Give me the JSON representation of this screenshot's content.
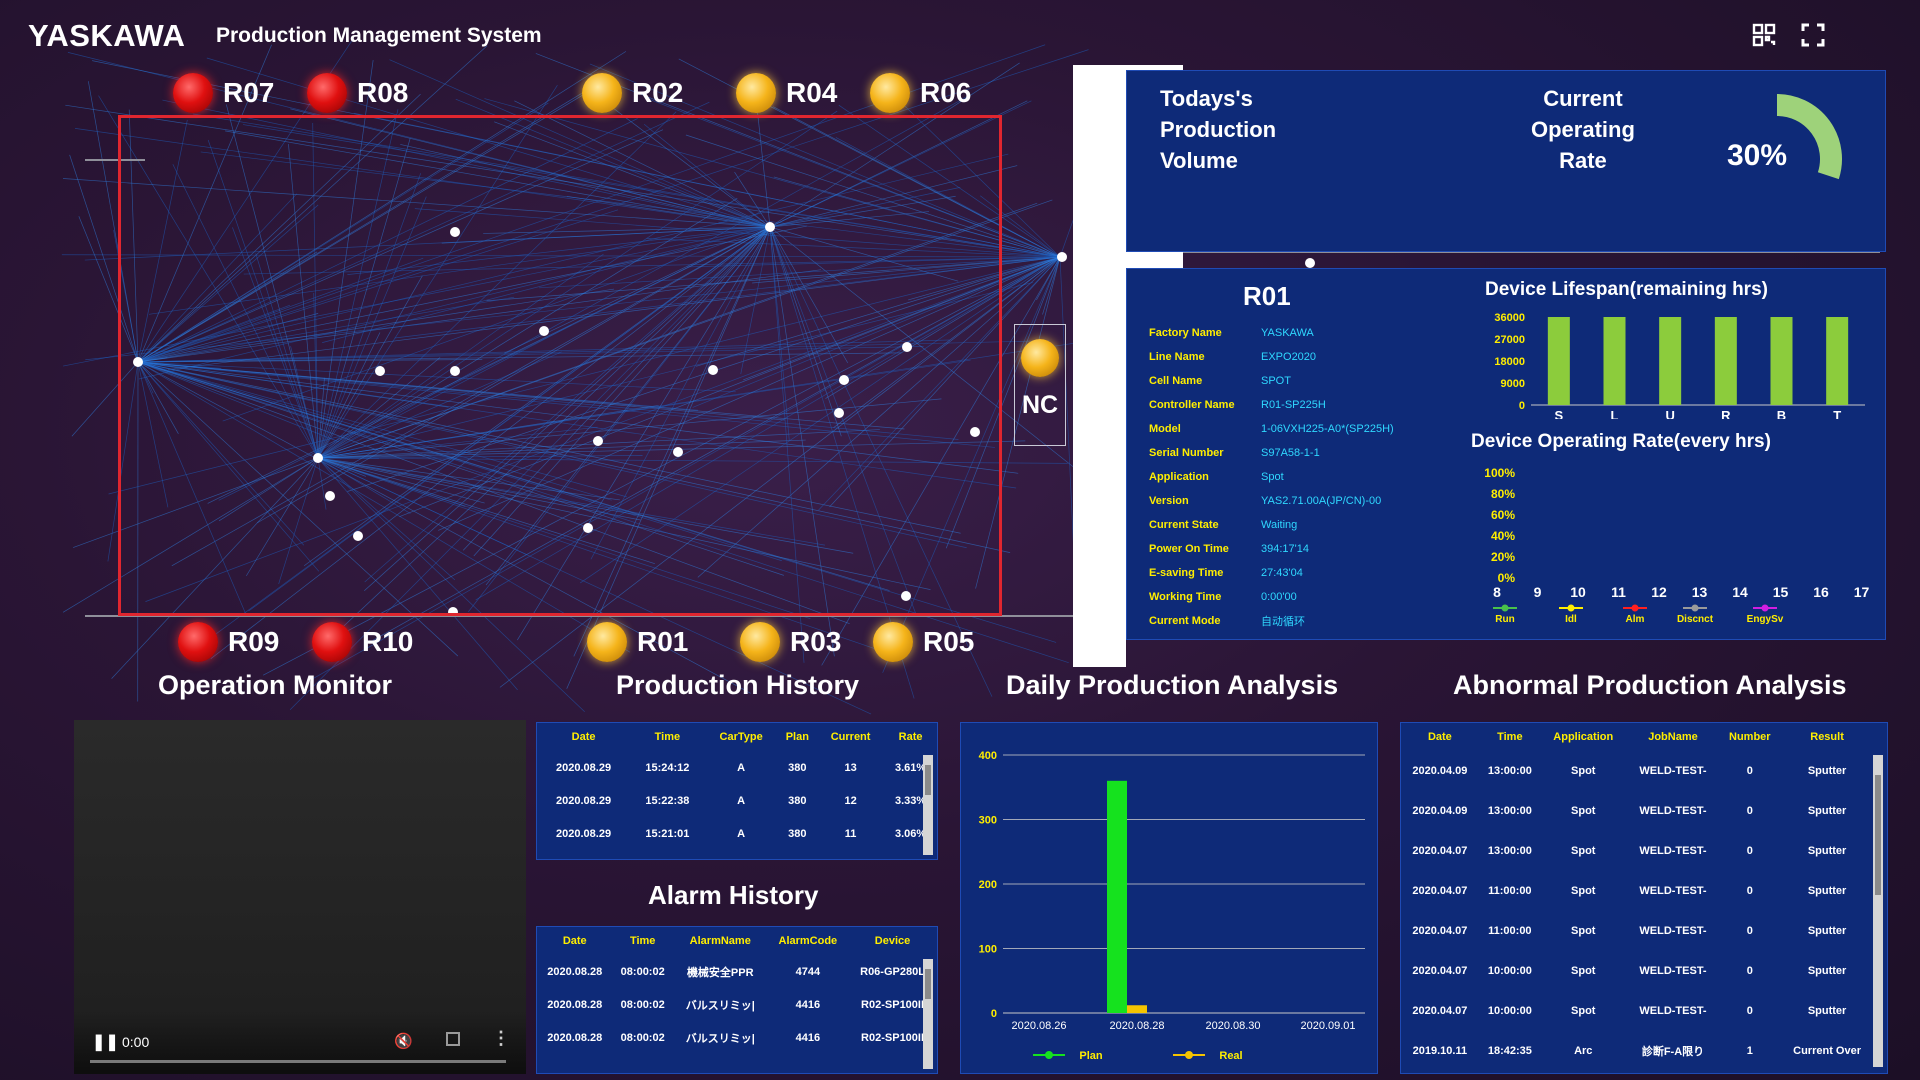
{
  "header": {
    "logo": "YASKAWA",
    "title": "Production Management System",
    "icons": [
      "qr-scan-icon",
      "fullscreen-icon"
    ]
  },
  "robots_top": [
    {
      "id": "R07",
      "status": "red"
    },
    {
      "id": "R08",
      "status": "red"
    },
    {
      "id": "R02",
      "status": "yellow"
    },
    {
      "id": "R04",
      "status": "yellow"
    },
    {
      "id": "R06",
      "status": "yellow"
    }
  ],
  "robots_bottom": [
    {
      "id": "R09",
      "status": "red"
    },
    {
      "id": "R10",
      "status": "red"
    },
    {
      "id": "R01",
      "status": "yellow"
    },
    {
      "id": "R03",
      "status": "yellow"
    },
    {
      "id": "R05",
      "status": "yellow"
    }
  ],
  "nc": {
    "label": "NC",
    "status": "yellow"
  },
  "production": {
    "volume_label": [
      "Todays's",
      "Production",
      "Volume"
    ],
    "rate_label": [
      "Current",
      "Operating",
      "Rate"
    ],
    "rate_value": "30%",
    "rate_fraction": 0.3
  },
  "r01": {
    "title": "R01",
    "info": [
      {
        "k": "Factory Name",
        "v": "YASKAWA"
      },
      {
        "k": "Line Name",
        "v": "EXPO2020"
      },
      {
        "k": "Cell Name",
        "v": "SPOT"
      },
      {
        "k": "Controller Name",
        "v": "R01-SP225H"
      },
      {
        "k": "Model",
        "v": "1-06VXH225-A0*(SP225H)"
      },
      {
        "k": "Serial Number",
        "v": "S97A58-1-1"
      },
      {
        "k": "Application",
        "v": "Spot"
      },
      {
        "k": "Version",
        "v": "YAS2.71.00A(JP/CN)-00"
      },
      {
        "k": "Current State",
        "v": "Waiting"
      },
      {
        "k": "Power On Time",
        "v": "394:17'14"
      },
      {
        "k": "E-saving Time",
        "v": "27:43'04"
      },
      {
        "k": "Working Time",
        "v": "0:00'00"
      },
      {
        "k": "Current Mode",
        "v": "自动循环"
      }
    ],
    "lifespan_title": "Device Lifespan(remaining hrs)",
    "oprate_title": "Device Operating Rate(every hrs)"
  },
  "chart_data": [
    {
      "type": "bar",
      "title": "Device Lifespan(remaining hrs)",
      "categories": [
        "S",
        "L",
        "U",
        "R",
        "B",
        "T"
      ],
      "values": [
        36000,
        36000,
        36000,
        36000,
        36000,
        36000
      ],
      "ylim": [
        0,
        36000
      ],
      "yticks": [
        "36000",
        "27000",
        "18000",
        "9000",
        "0"
      ],
      "color": "#8ccc3c"
    },
    {
      "type": "line",
      "title": "Device Operating Rate(every hrs)",
      "x": [
        "8",
        "9",
        "10",
        "11",
        "12",
        "13",
        "14",
        "15",
        "16",
        "17"
      ],
      "ylim": [
        0,
        100
      ],
      "yticks": [
        "100%",
        "80%",
        "60%",
        "40%",
        "20%",
        "0%"
      ],
      "series": [
        {
          "name": "Run",
          "color": "#49c24a",
          "values": []
        },
        {
          "name": "Idl",
          "color": "#ffee00",
          "values": []
        },
        {
          "name": "Alm",
          "color": "#ff2020",
          "values": []
        },
        {
          "name": "Discnct",
          "color": "#9a9a9a",
          "values": []
        },
        {
          "name": "EngySv",
          "color": "#d21ee0",
          "values": []
        }
      ]
    },
    {
      "type": "bar",
      "title": "Daily Production Analysis",
      "categories": [
        "2020.08.28"
      ],
      "x_ticks": [
        "2020.08.26",
        "2020.08.28",
        "2020.08.30",
        "2020.09.01"
      ],
      "ylim": [
        0,
        400
      ],
      "yticks": [
        "0",
        "100",
        "200",
        "300",
        "400"
      ],
      "series": [
        {
          "name": "Plan",
          "color": "#15e21e",
          "values": [
            360
          ]
        },
        {
          "name": "Real",
          "color": "#f5c400",
          "values": [
            12
          ]
        }
      ]
    }
  ],
  "sections": {
    "operation_monitor": "Operation Monitor",
    "production_history": "Production History",
    "daily_production": "Daily Production Analysis",
    "abnormal_production": "Abnormal Production Analysis",
    "alarm_history": "Alarm History"
  },
  "video": {
    "time": "0:00"
  },
  "production_history": {
    "columns": [
      "Date",
      "Time",
      "CarType",
      "Plan",
      "Current",
      "Rate"
    ],
    "rows": [
      [
        "2020.08.29",
        "15:24:12",
        "A",
        "380",
        "13",
        "3.61%"
      ],
      [
        "2020.08.29",
        "15:22:38",
        "A",
        "380",
        "12",
        "3.33%"
      ],
      [
        "2020.08.29",
        "15:21:01",
        "A",
        "380",
        "11",
        "3.06%"
      ]
    ]
  },
  "alarm_history": {
    "columns": [
      "Date",
      "Time",
      "AlarmName",
      "AlarmCode",
      "Device"
    ],
    "rows": [
      [
        "2020.08.28",
        "08:00:02",
        "機械安全PPR",
        "4744",
        "R06-GP280L"
      ],
      [
        "2020.08.28",
        "08:00:02",
        "バルスリミッ|",
        "4416",
        "R02-SP100II"
      ],
      [
        "2020.08.28",
        "08:00:02",
        "バルスリミッ|",
        "4416",
        "R02-SP100II"
      ]
    ]
  },
  "abnormal": {
    "columns": [
      "Date",
      "Time",
      "Application",
      "JobName",
      "Number",
      "Result"
    ],
    "rows": [
      [
        "2020.04.09",
        "13:00:00",
        "Spot",
        "WELD-TEST-",
        "0",
        "Sputter"
      ],
      [
        "2020.04.09",
        "13:00:00",
        "Spot",
        "WELD-TEST-",
        "0",
        "Sputter"
      ],
      [
        "2020.04.07",
        "13:00:00",
        "Spot",
        "WELD-TEST-",
        "0",
        "Sputter"
      ],
      [
        "2020.04.07",
        "11:00:00",
        "Spot",
        "WELD-TEST-",
        "0",
        "Sputter"
      ],
      [
        "2020.04.07",
        "11:00:00",
        "Spot",
        "WELD-TEST-",
        "0",
        "Sputter"
      ],
      [
        "2020.04.07",
        "10:00:00",
        "Spot",
        "WELD-TEST-",
        "0",
        "Sputter"
      ],
      [
        "2020.04.07",
        "10:00:00",
        "Spot",
        "WELD-TEST-",
        "0",
        "Sputter"
      ],
      [
        "2019.10.11",
        "18:42:35",
        "Arc",
        "診断F-A限り",
        "1",
        "Current Over"
      ]
    ]
  }
}
